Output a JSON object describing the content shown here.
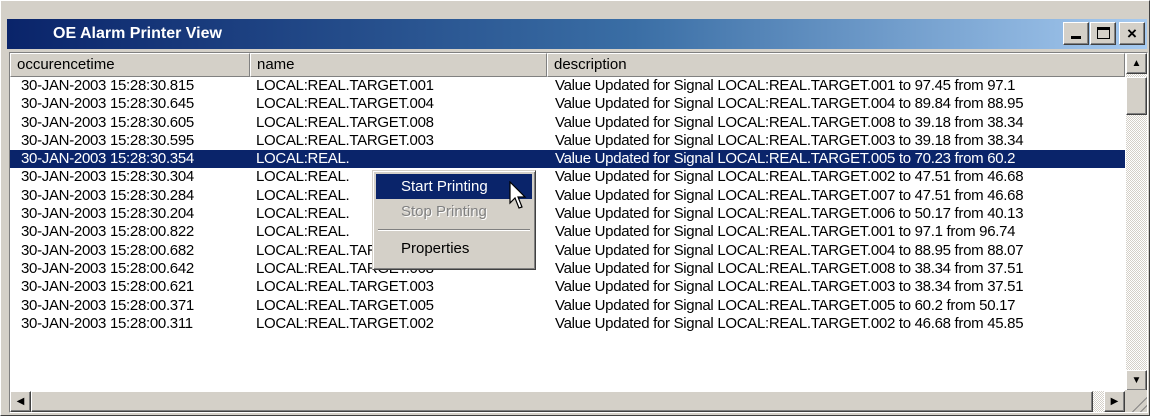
{
  "window": {
    "title": "OE Alarm Printer View",
    "close_glyph": "×"
  },
  "columns": [
    "occurencetime",
    "name",
    "description"
  ],
  "rows": [
    [
      "30-JAN-2003 15:28:30.815",
      "LOCAL:REAL.TARGET.001",
      "Value Updated for Signal LOCAL:REAL.TARGET.001 to 97.45 from 97.1"
    ],
    [
      "30-JAN-2003 15:28:30.645",
      "LOCAL:REAL.TARGET.004",
      "Value Updated for Signal LOCAL:REAL.TARGET.004 to 89.84 from 88.95"
    ],
    [
      "30-JAN-2003 15:28:30.605",
      "LOCAL:REAL.TARGET.008",
      "Value Updated for Signal LOCAL:REAL.TARGET.008 to 39.18 from 38.34"
    ],
    [
      "30-JAN-2003 15:28:30.595",
      "LOCAL:REAL.TARGET.003",
      "Value Updated for Signal LOCAL:REAL.TARGET.003 to 39.18 from 38.34"
    ],
    [
      "30-JAN-2003 15:28:30.354",
      "LOCAL:REAL.",
      "Value Updated for Signal LOCAL:REAL.TARGET.005 to 70.23 from 60.2"
    ],
    [
      "30-JAN-2003 15:28:30.304",
      "LOCAL:REAL.",
      "Value Updated for Signal LOCAL:REAL.TARGET.002 to 47.51 from 46.68"
    ],
    [
      "30-JAN-2003 15:28:30.284",
      "LOCAL:REAL.",
      "Value Updated for Signal LOCAL:REAL.TARGET.007 to 47.51 from 46.68"
    ],
    [
      "30-JAN-2003 15:28:30.204",
      "LOCAL:REAL.",
      "Value Updated for Signal LOCAL:REAL.TARGET.006 to 50.17 from 40.13"
    ],
    [
      "30-JAN-2003 15:28:00.822",
      "LOCAL:REAL.",
      "Value Updated for Signal LOCAL:REAL.TARGET.001 to 97.1 from 96.74"
    ],
    [
      "30-JAN-2003 15:28:00.682",
      "LOCAL:REAL.TARGET.004",
      "Value Updated for Signal LOCAL:REAL.TARGET.004 to 88.95 from 88.07"
    ],
    [
      "30-JAN-2003 15:28:00.642",
      "LOCAL:REAL.TARGET.008",
      "Value Updated for Signal LOCAL:REAL.TARGET.008 to 38.34 from 37.51"
    ],
    [
      "30-JAN-2003 15:28:00.621",
      "LOCAL:REAL.TARGET.003",
      "Value Updated for Signal LOCAL:REAL.TARGET.003 to 38.34 from 37.51"
    ],
    [
      "30-JAN-2003 15:28:00.371",
      "LOCAL:REAL.TARGET.005",
      "Value Updated for Signal LOCAL:REAL.TARGET.005 to 60.2 from 50.17"
    ],
    [
      "30-JAN-2003 15:28:00.311",
      "LOCAL:REAL.TARGET.002",
      "Value Updated for Signal LOCAL:REAL.TARGET.002 to 46.68 from 45.85"
    ]
  ],
  "selected_row": 4,
  "context_menu": {
    "items": [
      {
        "label": "Start Printing",
        "state": "highlighted"
      },
      {
        "label": "Stop Printing",
        "state": "disabled"
      },
      {
        "label": "Properties",
        "state": "normal"
      }
    ]
  },
  "scrollbar": {
    "up_glyph": "▲",
    "down_glyph": "▼",
    "left_glyph": "◀",
    "right_glyph": "▶"
  },
  "colors": {
    "title_active": "#0a246a",
    "selection": "#0a246a",
    "face": "#d4d0c8"
  }
}
